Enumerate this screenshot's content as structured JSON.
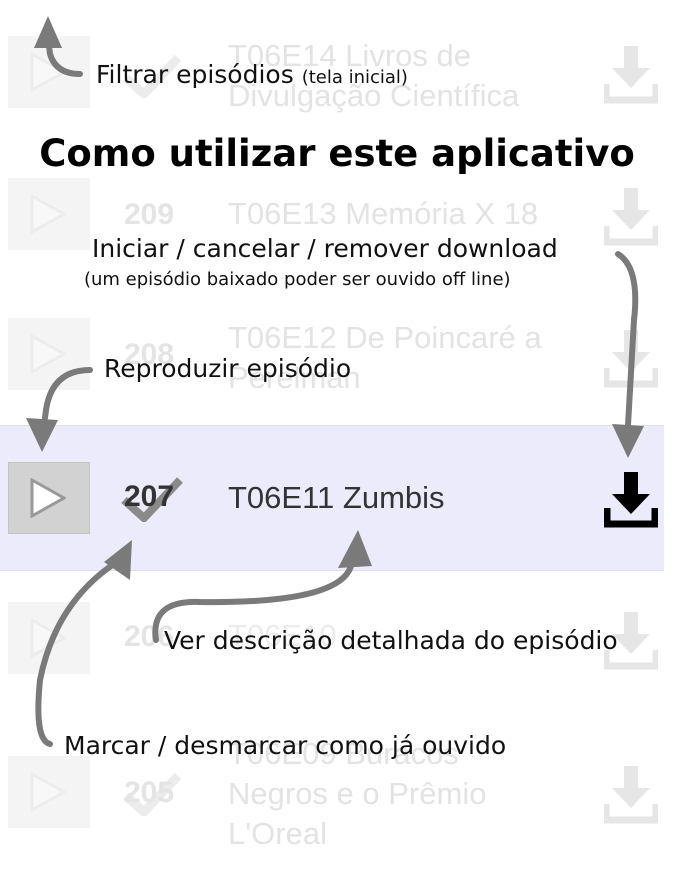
{
  "background_list": [
    {
      "number": "",
      "title_lines": [
        "T06E14 Livros de",
        "Divulgação Científica"
      ]
    },
    {
      "number": "209",
      "title_lines": [
        "T06E13 Memória X 18"
      ]
    },
    {
      "number": "208",
      "title_lines": [
        "T06E12 De Poincaré a",
        "Perelman"
      ]
    },
    {
      "number": "206",
      "title_lines": [
        "T06E10 ..."
      ]
    },
    {
      "number": "205",
      "title_lines": [
        "T06E09 Buracos",
        "Negros e o Prêmio",
        "L'Oreal"
      ]
    }
  ],
  "highlighted_episode": {
    "number": "207",
    "title": "T06E11 Zumbis"
  },
  "heading": "Como utilizar este aplicativo",
  "annotations": {
    "filter": {
      "main": "Filtrar episódios",
      "small": "(tela inicial)"
    },
    "download": {
      "main": "Iniciar / cancelar / remover download",
      "sub": "(um episódio baixado poder ser ouvido off line)"
    },
    "play": "Reproduzir episódio",
    "details": "Ver descrição detalhada do episódio",
    "mark": "Marcar / desmarcar como já ouvido"
  },
  "icons": [
    "play-icon",
    "check-icon",
    "download-icon",
    "arrow-icon"
  ],
  "colors": {
    "highlight_row": "#ebebfb",
    "arrow": "#7a7a7a",
    "heading": "#000000"
  }
}
